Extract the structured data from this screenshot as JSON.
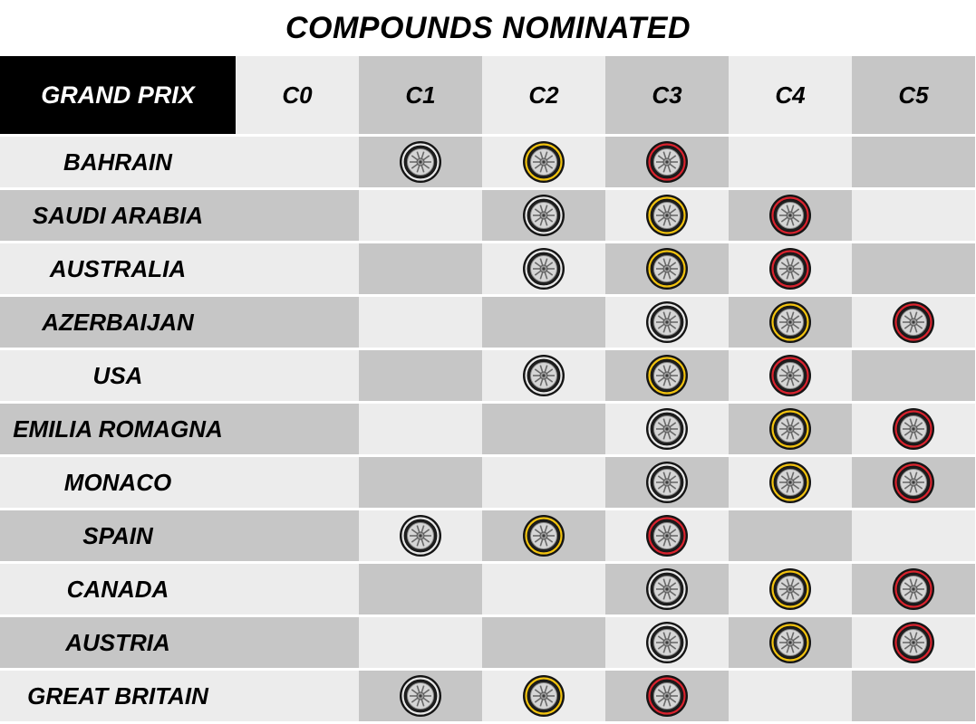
{
  "title": "COMPOUNDS NOMINATED",
  "header": {
    "grand_prix": "GRAND PRIX",
    "compounds": [
      "C0",
      "C1",
      "C2",
      "C3",
      "C4",
      "C5"
    ]
  },
  "tyre_colors": {
    "hard": "#e8e8e8",
    "medium": "#f2c30f",
    "soft": "#d9232e"
  },
  "table": {
    "columns": [
      "Grand Prix",
      "C0",
      "C1",
      "C2",
      "C3",
      "C4",
      "C5"
    ],
    "rows": [
      {
        "name": "BAHRAIN",
        "cells": [
          null,
          "hard",
          "medium",
          "soft",
          null,
          null
        ]
      },
      {
        "name": "SAUDI ARABIA",
        "cells": [
          null,
          null,
          "hard",
          "medium",
          "soft",
          null
        ]
      },
      {
        "name": "AUSTRALIA",
        "cells": [
          null,
          null,
          "hard",
          "medium",
          "soft",
          null
        ]
      },
      {
        "name": "AZERBAIJAN",
        "cells": [
          null,
          null,
          null,
          "hard",
          "medium",
          "soft"
        ]
      },
      {
        "name": "USA",
        "cells": [
          null,
          null,
          "hard",
          "medium",
          "soft",
          null
        ]
      },
      {
        "name": "EMILIA ROMAGNA",
        "cells": [
          null,
          null,
          null,
          "hard",
          "medium",
          "soft"
        ]
      },
      {
        "name": "MONACO",
        "cells": [
          null,
          null,
          null,
          "hard",
          "medium",
          "soft"
        ]
      },
      {
        "name": "SPAIN",
        "cells": [
          null,
          "hard",
          "medium",
          "soft",
          null,
          null
        ]
      },
      {
        "name": "CANADA",
        "cells": [
          null,
          null,
          null,
          "hard",
          "medium",
          "soft"
        ]
      },
      {
        "name": "AUSTRIA",
        "cells": [
          null,
          null,
          null,
          "hard",
          "medium",
          "soft"
        ]
      },
      {
        "name": "GREAT BRITAIN",
        "cells": [
          null,
          "hard",
          "medium",
          "soft",
          null,
          null
        ]
      }
    ]
  }
}
